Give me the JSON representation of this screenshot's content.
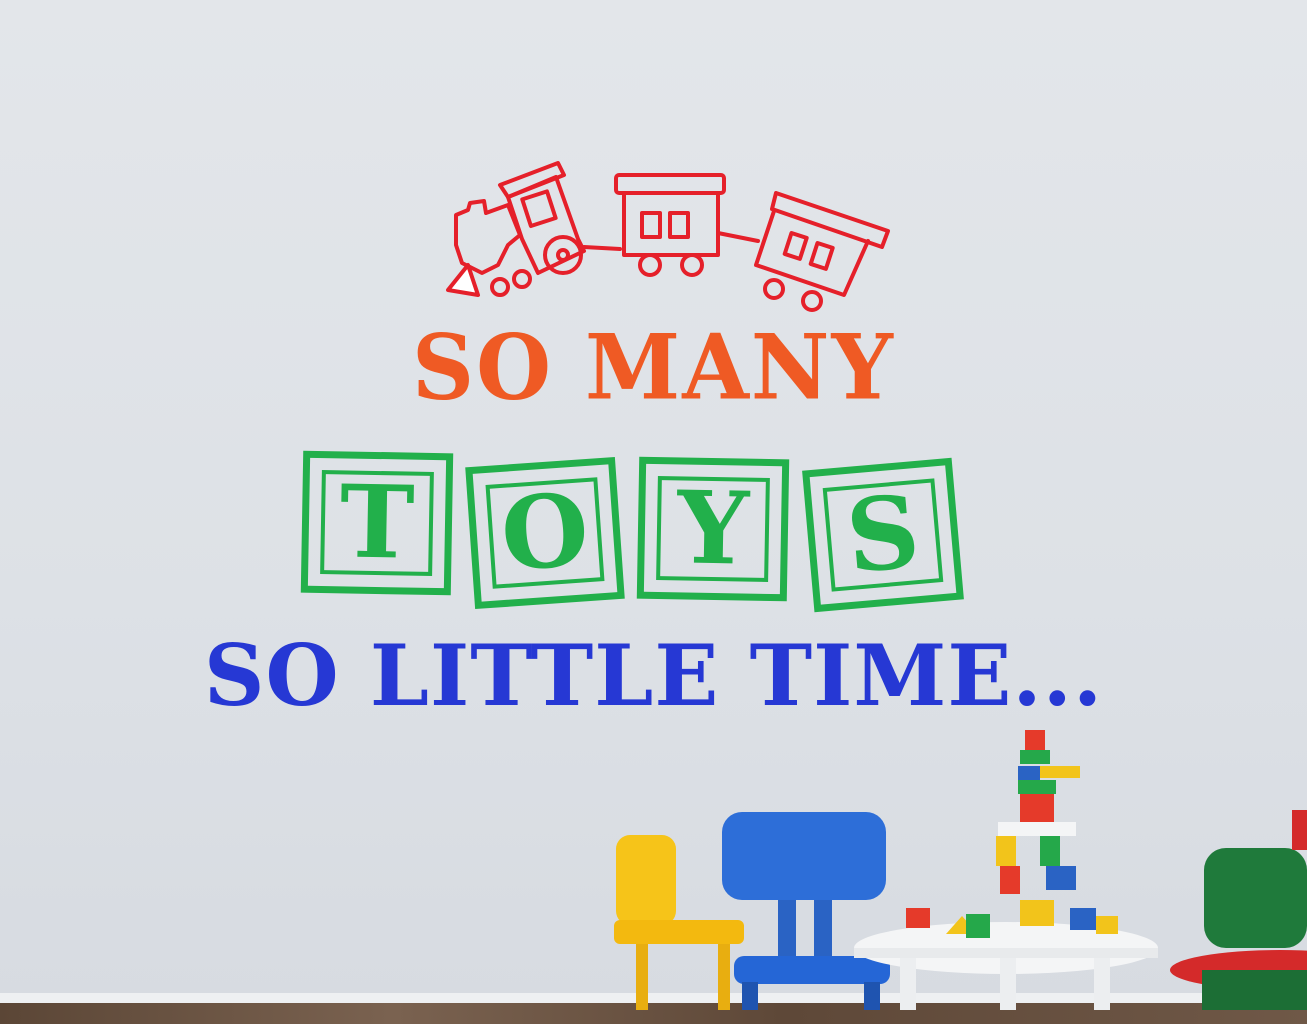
{
  "decal": {
    "line1": "SO MANY",
    "blocks": [
      "T",
      "O",
      "Y",
      "S"
    ],
    "line3": "SO LITTLE TIME..."
  },
  "colors": {
    "train": "#e5202a",
    "line1": "#ef5a24",
    "blocks": "#22b04b",
    "line3": "#2638d4",
    "wall": "#e0e3e7"
  },
  "scene": {
    "icons": [
      "toy-train-icon",
      "yellow-chair",
      "blue-chair",
      "white-table",
      "toy-block-tower",
      "green-chair"
    ]
  }
}
